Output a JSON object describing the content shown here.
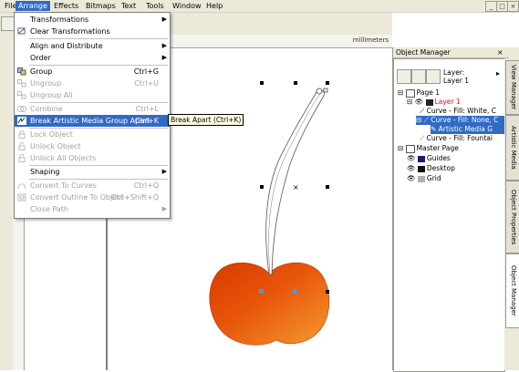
{
  "menubar": {
    "items": [
      {
        "label": "File",
        "active": false
      },
      {
        "label": "Arrange",
        "active": true
      },
      {
        "label": "Effects",
        "active": false
      },
      {
        "label": "Bitmaps",
        "active": false
      },
      {
        "label": "Text",
        "active": false
      },
      {
        "label": "Tools",
        "active": false
      },
      {
        "label": "Window",
        "active": false
      },
      {
        "label": "Help",
        "active": false
      }
    ],
    "window_controls": [
      "_",
      "□",
      "×"
    ]
  },
  "ruler": {
    "unit": "millimeters"
  },
  "arrange_menu": {
    "items": [
      {
        "label": "Transformations",
        "shortcut": "",
        "submenu": true,
        "enabled": true,
        "icon": "none"
      },
      {
        "label": "Clear Transformations",
        "shortcut": "",
        "submenu": false,
        "enabled": true,
        "icon": "clear-transform-icon"
      },
      {
        "label": "Align and Distribute",
        "shortcut": "",
        "submenu": true,
        "enabled": true,
        "icon": "none"
      },
      {
        "label": "Order",
        "shortcut": "",
        "submenu": true,
        "enabled": true,
        "icon": "none"
      },
      {
        "label": "Group",
        "shortcut": "Ctrl+G",
        "submenu": false,
        "enabled": true,
        "icon": "group-icon"
      },
      {
        "label": "Ungroup",
        "shortcut": "Ctrl+U",
        "submenu": false,
        "enabled": false,
        "icon": "ungroup-icon"
      },
      {
        "label": "Ungroup All",
        "shortcut": "",
        "submenu": false,
        "enabled": false,
        "icon": "ungroup-all-icon"
      },
      {
        "label": "Combine",
        "shortcut": "Ctrl+L",
        "submenu": false,
        "enabled": false,
        "icon": "combine-icon"
      },
      {
        "label": "Break Artistic Media Group Apart",
        "shortcut": "Ctrl+K",
        "submenu": false,
        "enabled": true,
        "icon": "break-apart-icon",
        "highlighted": true
      },
      {
        "label": "Lock Object",
        "shortcut": "",
        "submenu": false,
        "enabled": false,
        "icon": "lock-icon"
      },
      {
        "label": "Unlock Object",
        "shortcut": "",
        "submenu": false,
        "enabled": false,
        "icon": "unlock-icon"
      },
      {
        "label": "Unlock All Objects",
        "shortcut": "",
        "submenu": false,
        "enabled": false,
        "icon": "unlock-all-icon"
      },
      {
        "label": "Shaping",
        "shortcut": "",
        "submenu": true,
        "enabled": true,
        "icon": "none"
      },
      {
        "label": "Convert To Curves",
        "shortcut": "Ctrl+Q",
        "submenu": false,
        "enabled": false,
        "icon": "convert-curves-icon"
      },
      {
        "label": "Convert Outline To Object",
        "shortcut": "Ctrl+Shift+Q",
        "submenu": false,
        "enabled": false,
        "icon": "convert-outline-icon"
      },
      {
        "label": "Close Path",
        "shortcut": "",
        "submenu": true,
        "enabled": false,
        "icon": "none"
      }
    ],
    "tooltip": "Break Apart (Ctrl+K)"
  },
  "object_manager": {
    "title": "Object Manager",
    "layer_label": "Layer:",
    "layer_value": "Layer 1",
    "tree": [
      {
        "label": "Page 1",
        "level": 0
      },
      {
        "label": "Layer 1",
        "level": 1,
        "color": "#ff0000"
      },
      {
        "label": "Curve - Fill: White, C",
        "level": 2
      },
      {
        "label": "Curve - Fill: None, C",
        "level": 2,
        "selected": true
      },
      {
        "label": "Artistic Media G",
        "level": 3,
        "selected": true
      },
      {
        "label": "Curve - Fill: Fountai",
        "level": 2
      },
      {
        "label": "Master Page",
        "level": 0
      },
      {
        "label": "Guides",
        "level": 1,
        "swatch": "#1a1a6e"
      },
      {
        "label": "Desktop",
        "level": 1,
        "swatch": "#111111"
      },
      {
        "label": "Grid",
        "level": 1,
        "swatch": "#b0b0b0"
      }
    ]
  },
  "docker_tabs": [
    "View Manager",
    "Artistic Media",
    "Object Properties",
    "Object Manager"
  ],
  "colors": {
    "menu_highlight": "#316ac5",
    "cherry_dark": "#d83a00",
    "cherry_light": "#f08a20",
    "ui_face": "#ece9d8"
  }
}
